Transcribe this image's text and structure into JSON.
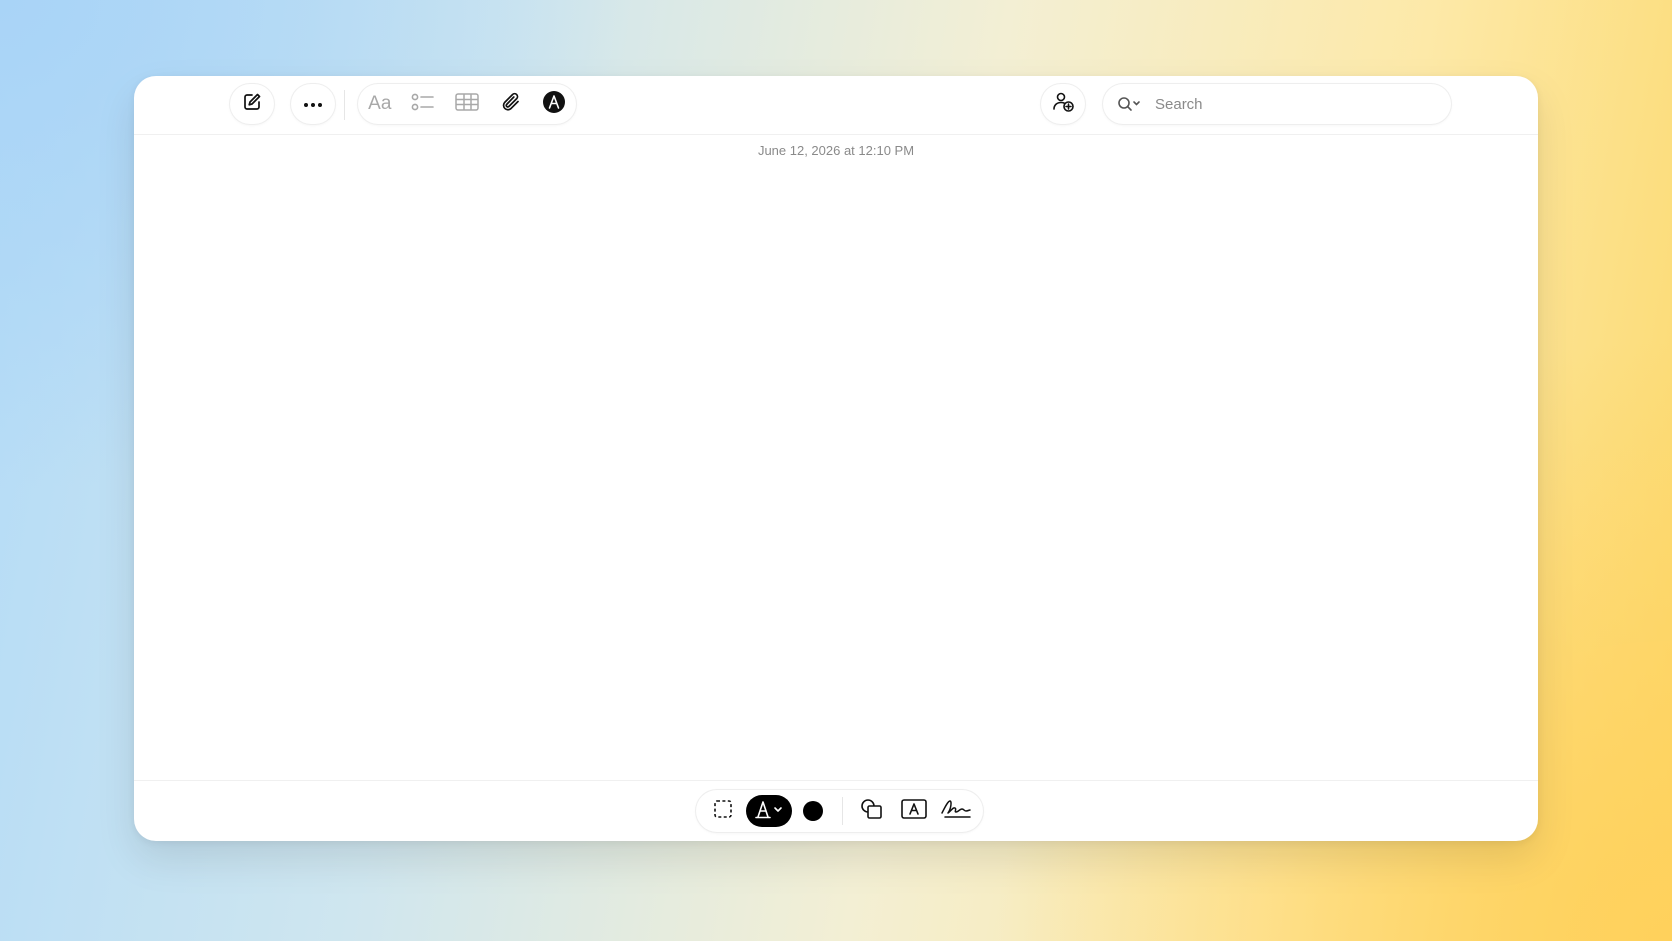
{
  "window": {
    "timestamp": "June 12, 2026 at 12:10 PM"
  },
  "toolbar": {
    "new_note": {
      "icon": "compose-icon"
    },
    "more": {
      "icon": "more-icon"
    },
    "format": {
      "label": "Aa",
      "icon": "text-format-icon"
    },
    "checklist": {
      "icon": "checklist-icon"
    },
    "table": {
      "icon": "table-icon"
    },
    "attachment": {
      "icon": "paperclip-icon"
    },
    "markup": {
      "icon": "markup-icon"
    },
    "collaborate": {
      "icon": "collaborate-icon"
    },
    "search": {
      "placeholder": "Search",
      "icon": "search-icon"
    }
  },
  "markup_toolbar": {
    "tools": [
      {
        "name": "selection-tool",
        "icon": "dashed-selection-icon",
        "active": false
      },
      {
        "name": "pen-tool",
        "icon": "pen-icon",
        "active": true
      },
      {
        "name": "color-picker",
        "icon": "color-dot-icon",
        "color": "#000000"
      },
      {
        "name": "shapes-tool",
        "icon": "shapes-icon"
      },
      {
        "name": "text-box-tool",
        "icon": "text-box-icon"
      },
      {
        "name": "signature-tool",
        "icon": "signature-icon"
      }
    ]
  },
  "colors": {
    "accent": "#000000",
    "muted_text": "#8a8a8a",
    "icon_gray": "#a8a8a8"
  }
}
